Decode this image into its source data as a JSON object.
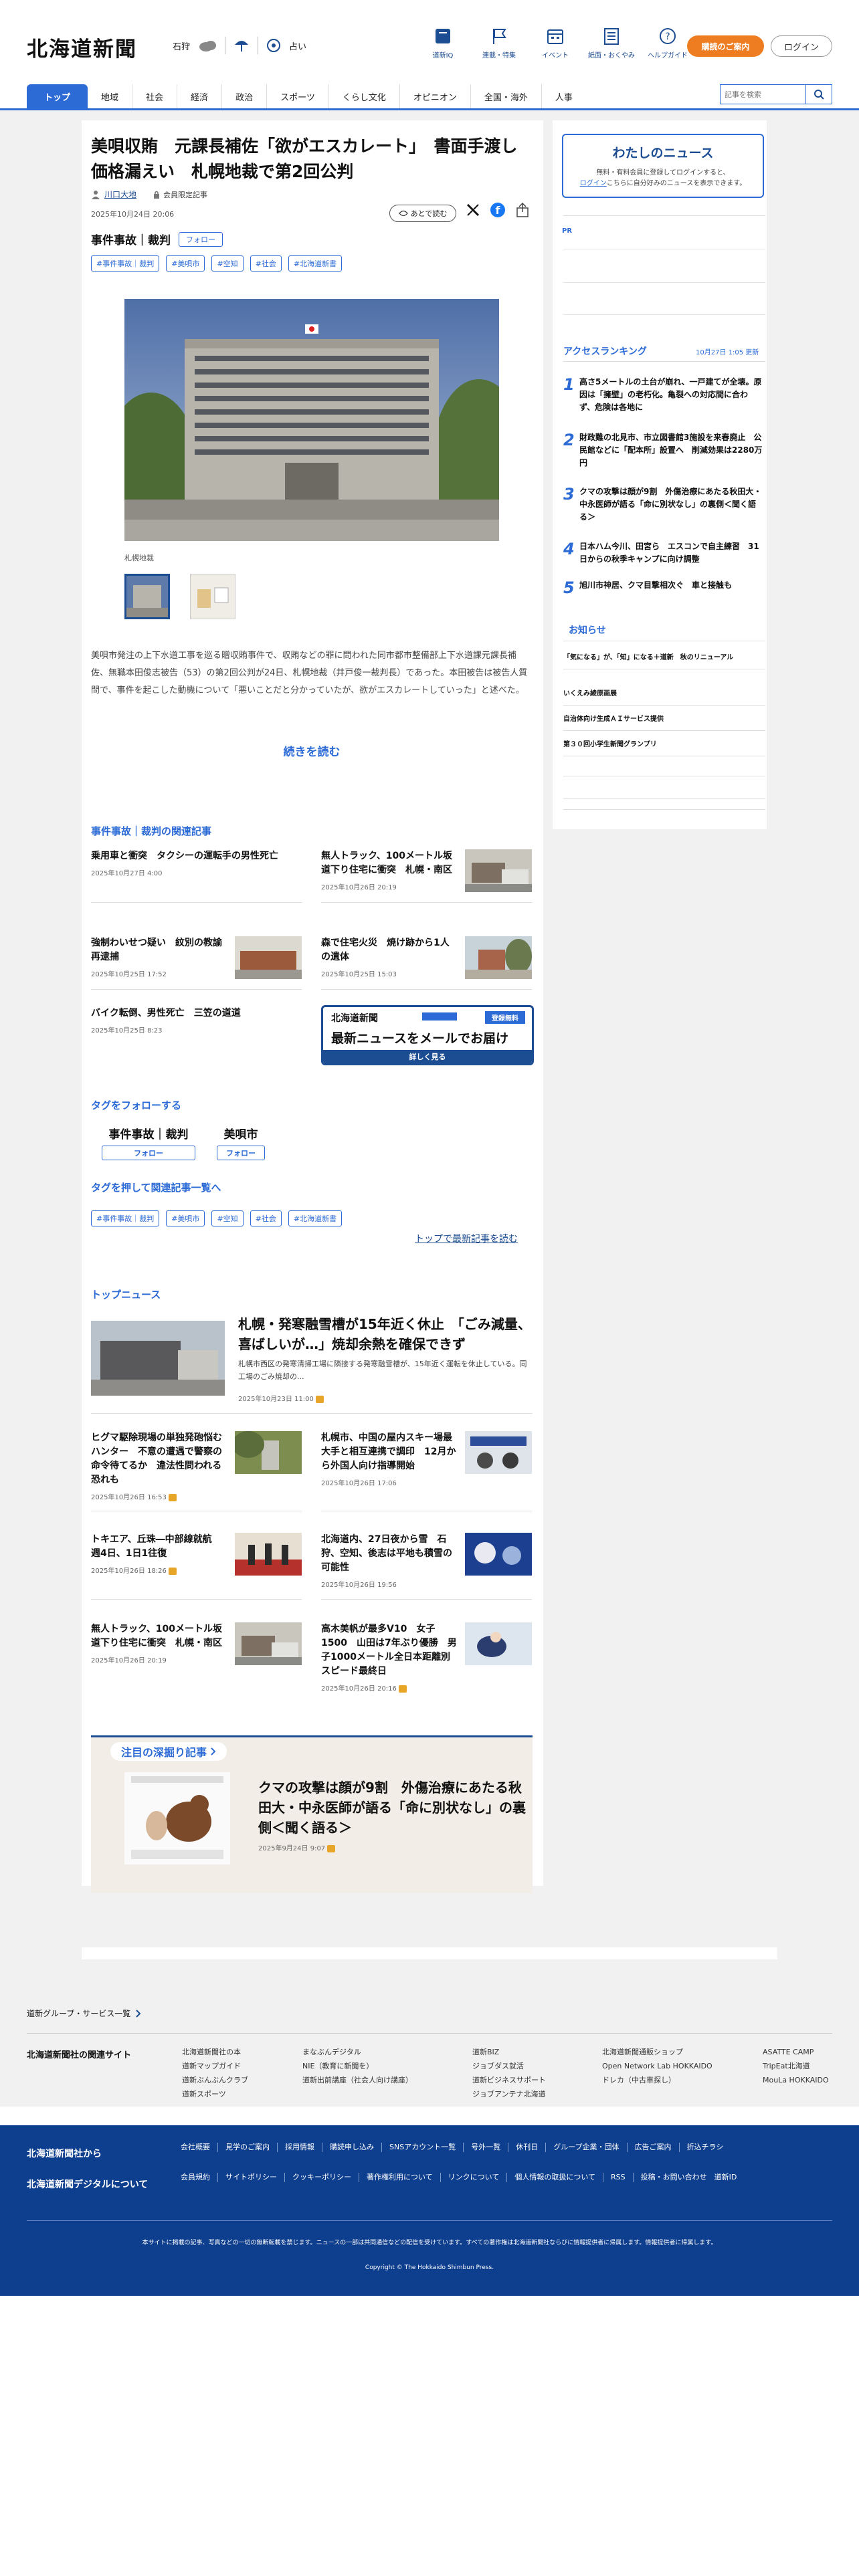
{
  "header": {
    "logo": "北海道新聞",
    "weather": {
      "city": "石狩",
      "rain_chance": "占い"
    },
    "icons": [
      {
        "label": "道新IQ",
        "icon": "book-icon"
      },
      {
        "label": "連載・特集",
        "icon": "flag-icon"
      },
      {
        "label": "イベント",
        "icon": "calendar-icon"
      },
      {
        "label": "紙面・おくやみ",
        "icon": "newspaper-icon"
      },
      {
        "label": "ヘルプガイド",
        "icon": "help-icon"
      }
    ],
    "subscribe_label": "購読のご案内",
    "login_label": "ログイン"
  },
  "nav": {
    "items": [
      "トップ",
      "地域",
      "社会",
      "経済",
      "政治",
      "スポーツ",
      "くらし文化",
      "オピニオン",
      "全国・海外",
      "人事"
    ],
    "search_placeholder": "記事を検索"
  },
  "article": {
    "title": "美唄収賄　元課長補佐「欲がエスカレート」　書面手渡し価格漏えい　札幌地裁で第2回公判",
    "author": "川口大地",
    "premium_label": "会員限定記事",
    "date": "2025年10月24日 20:06",
    "save_label": "あとで読む",
    "category": "事件事故｜裁判",
    "follow_label": "フォロー",
    "tags": [
      "#事件事故｜裁判",
      "#美唄市",
      "#空知",
      "#社会",
      "#北海道新書"
    ],
    "photo_caption": "札幌地裁",
    "body": "美唄市発注の上下水道工事を巡る贈収賄事件で、収賄などの罪に問われた同市都市整備部上下水道課元課長補佐、無職本田俊志被告（53）の第2回公判が24日、札幌地裁（井戸俊一裁判長）であった。本田被告は被告人質問で、事件を起こした動機について「悪いことだと分かっていたが、欲がエスカレートしていった」と述べた。",
    "read_more": "続きを読む"
  },
  "related": {
    "title": "事件事故｜裁判の関連記事",
    "items": [
      {
        "title": "乗用車と衝突　タクシーの運転手の男性死亡",
        "date": "2025年10月27日 4:00"
      },
      {
        "title": "無人トラック、100メートル坂道下り住宅に衝突　札幌・南区",
        "date": "2025年10月26日 20:19"
      },
      {
        "title": "強制わいせつ疑い　紋別の教諭再逮捕",
        "date": "2025年10月25日 17:52"
      },
      {
        "title": "森で住宅火災　焼け跡から1人の遺体",
        "date": "2025年10月25日 15:03"
      },
      {
        "title": "バイク転倒、男性死亡　三笠の道道",
        "date": "2025年10月25日 8:23"
      }
    ]
  },
  "mail_banner": {
    "logo": "北海道新聞",
    "badge": "登録無料",
    "headline": "最新ニュースをメールでお届け",
    "cta": "詳しく見る"
  },
  "follow_tags": {
    "title": "タグをフォローする",
    "items": [
      {
        "label": "事件事故｜裁判",
        "btn": "フォロー"
      },
      {
        "label": "美唄市",
        "btn": "フォロー"
      }
    ]
  },
  "tag_list": {
    "title": "タグを押して関連記事一覧へ",
    "tags": [
      "#事件事故｜裁判",
      "#美唄市",
      "#空知",
      "#社会",
      "#北海道新書"
    ],
    "latest_link": "トップで最新記事を読む"
  },
  "top_news": {
    "title": "トップニュース",
    "lead": {
      "title": "札幌・発寒融雪槽が15年近く休止　「ごみ減量、喜ばしいが…」焼却余熱を確保できず",
      "summary": "札幌市西区の発寒清掃工場に隣接する発寒融雪槽が、15年近く運転を休止している。同工場のごみ焼却の...",
      "date": "2025年10月23日 11:00"
    },
    "items": [
      {
        "title": "ヒグマ駆除現場の単独発砲悩むハンター　不意の遭遇で警察の命令待てるか　違法性問われる恐れも",
        "date": "2025年10月26日 16:53"
      },
      {
        "title": "札幌市、中国の屋内スキー場最大手と相互連携で調印　12月から外国人向け指導開始",
        "date": "2025年10月26日 17:06"
      },
      {
        "title": "トキエア、丘珠―中部線就航　週4日、1日1往復",
        "date": "2025年10月26日 18:26"
      },
      {
        "title": "北海道内、27日夜から雪　石狩、空知、後志は平地も積雪の可能性",
        "date": "2025年10月26日 19:56"
      },
      {
        "title": "無人トラック、100メートル坂道下り住宅に衝突　札幌・南区",
        "date": "2025年10月26日 20:19"
      },
      {
        "title": "高木美帆が最多V10　女子1500　山田は7年ぶり優勝　男子1000メートル全日本距離別スピード最終日",
        "date": "2025年10月26日 20:16"
      }
    ]
  },
  "deep_dive": {
    "label": "注目の深掘り記事",
    "title": "クマの攻撃は顔が9割　外傷治療にあたる秋田大・中永医師が語る「命に別状なし」の裏側＜聞く語る＞",
    "date": "2025年9月24日 9:07"
  },
  "sidebar": {
    "mynews_title": "わたしのニュース",
    "mynews_text1": "無料・有料会員に登録してログインすると、",
    "mynews_login": "ログイン",
    "mynews_text2": "こちらに自分好みのニュースを表示できます。",
    "pr": "PR",
    "ranking_title": "アクセスランキング",
    "ranking_time": "10月27日 1:05 更新",
    "ranking": [
      {
        "n": "1",
        "title": "高さ5メートルの土台が崩れ、一戸建てが全壊。原因は「擁壁」の老朽化。亀裂への対応間に合わず、危険は各地に"
      },
      {
        "n": "2",
        "title": "財政難の北見市、市立図書館3施設を来春廃止　公民館などに「配本所」設置へ　削減効果は2280万円"
      },
      {
        "n": "3",
        "title": "クマの攻撃は顔が9割　外傷治療にあたる秋田大・中永医師が語る「命に別状なし」の裏側＜聞く語る＞"
      },
      {
        "n": "4",
        "title": "日本ハム今川、田宮ら　エスコンで自主練習　31日からの秋季キャンプに向け調整"
      },
      {
        "n": "5",
        "title": "旭川市神居、クマ目撃相次ぐ　車と接触も"
      }
    ],
    "notice_title": "お知らせ",
    "notices": [
      "「気になる」が、「知」になる＋道新　秋のリニューアル",
      "いくえみ綾原画展",
      "自治体向け生成ＡＩサービス提供",
      "第３０回小学生新聞グランプリ"
    ]
  },
  "footer": {
    "group_link": "道新グループ・サービス一覧",
    "related_title": "北海道新聞社の関連サイト",
    "sites_col1": [
      "北海道新聞社の本",
      "道新マップガイド",
      "道新ぶんぶんクラブ",
      "道新スポーツ"
    ],
    "sites_col2": [
      "まなぶんデジタル",
      "NIE（教育に新聞を）",
      "道新出前講座（社会人向け講座）"
    ],
    "sites_col3": [
      "道新BIZ",
      "ジョブダス就活",
      "道新ビジネスサポート",
      "ジョブアンテナ北海道"
    ],
    "sites_col4": [
      "北海道新聞通販ショップ",
      "Open Network Lab HOKKAIDO",
      "ドレカ（中古車探し）"
    ],
    "sites_col5": [
      "ASATTE CAMP",
      "TripEat北海道",
      "MouLa HOKKAIDO"
    ],
    "from_company": "北海道新聞社から",
    "about_digital": "北海道新聞デジタルについて",
    "links1": [
      "会社概要",
      "見学のご案内",
      "採用情報",
      "購読申し込み",
      "SNSアカウント一覧",
      "号外一覧",
      "休刊日",
      "グループ企業・団体",
      "広告ご案内",
      "折込チラシ"
    ],
    "links2": [
      "会員規約",
      "サイトポリシー",
      "クッキーポリシー",
      "著作権利用について",
      "リンクについて",
      "個人情報の取扱について",
      "RSS",
      "投稿・お問い合わせ",
      "道新ID"
    ],
    "note": "本サイトに掲載の記事、写真などの一切の無断転載を禁じます。ニュースの一部は共同通信などの配信を受けています。すべての著作権は北海道新聞社ならびに情報提供者に帰属します。情報提供者に帰属します。",
    "copyright": "Copyright © The Hokkaido Shimbun Press."
  },
  "colors": {
    "brand_blue": "#1c4c91",
    "accent_blue": "#2c6bd6",
    "orange": "#ee7d22",
    "footer_bg": "#0e3e8e"
  }
}
